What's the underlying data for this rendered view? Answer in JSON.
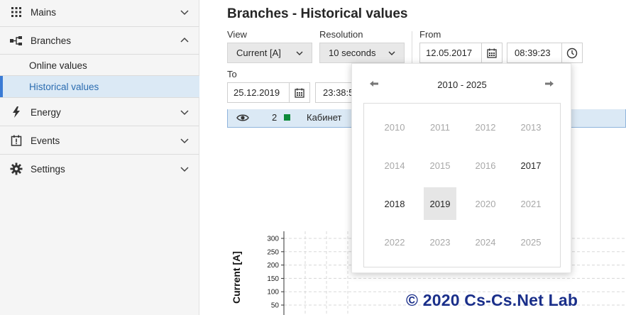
{
  "sidebar": {
    "items": [
      {
        "label": "Mains",
        "icon": "grid-icon",
        "state": "collapsed"
      },
      {
        "label": "Branches",
        "icon": "branches-icon",
        "state": "expanded"
      },
      {
        "label": "Energy",
        "icon": "lightning-icon",
        "state": "collapsed"
      },
      {
        "label": "Events",
        "icon": "events-icon",
        "state": "collapsed"
      },
      {
        "label": "Settings",
        "icon": "gear-icon",
        "state": "collapsed"
      }
    ],
    "subitems": [
      {
        "label": "Online values",
        "active": false
      },
      {
        "label": "Historical values",
        "active": true
      }
    ]
  },
  "page": {
    "title": "Branches - Historical values",
    "view_label": "View",
    "view_value": "Current [A]",
    "resolution_label": "Resolution",
    "resolution_value": "10 seconds",
    "from_label": "From",
    "from_date": "12.05.2017",
    "from_time": "08:39:23",
    "to_label": "To",
    "to_date": "25.12.2019",
    "to_time": "23:38:5"
  },
  "branch_row": {
    "number": "2",
    "name": "Кабинет",
    "color": "#0e8a3a"
  },
  "year_picker": {
    "range": "2010 - 2025",
    "years": [
      "2010",
      "2011",
      "2012",
      "2013",
      "2014",
      "2015",
      "2016",
      "2017",
      "2018",
      "2019",
      "2020",
      "2021",
      "2022",
      "2023",
      "2024",
      "2025"
    ],
    "enabled": [
      "2017",
      "2018",
      "2019"
    ],
    "selected": "2019"
  },
  "chart": {
    "ylabel": "Current [A]",
    "yticks": [
      "300",
      "250",
      "200",
      "150",
      "100",
      "50"
    ]
  },
  "watermark": "© 2020 Cs-Cs.Net Lab",
  "colors": {
    "accent": "#3a7bd5",
    "active_bg": "#dbe9f5",
    "watermark": "#1a2f8a"
  }
}
